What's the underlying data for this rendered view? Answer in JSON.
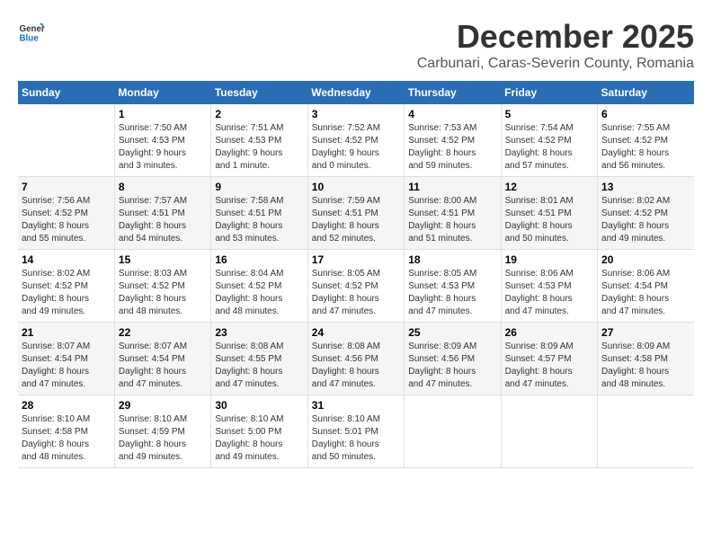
{
  "header": {
    "logo_general": "General",
    "logo_blue": "Blue",
    "title": "December 2025",
    "subtitle": "Carbunari, Caras-Severin County, Romania"
  },
  "calendar": {
    "weekdays": [
      "Sunday",
      "Monday",
      "Tuesday",
      "Wednesday",
      "Thursday",
      "Friday",
      "Saturday"
    ],
    "weeks": [
      [
        {
          "day": "",
          "sunrise": "",
          "sunset": "",
          "daylight": ""
        },
        {
          "day": "1",
          "sunrise": "Sunrise: 7:50 AM",
          "sunset": "Sunset: 4:53 PM",
          "daylight": "Daylight: 9 hours and 3 minutes."
        },
        {
          "day": "2",
          "sunrise": "Sunrise: 7:51 AM",
          "sunset": "Sunset: 4:53 PM",
          "daylight": "Daylight: 9 hours and 1 minute."
        },
        {
          "day": "3",
          "sunrise": "Sunrise: 7:52 AM",
          "sunset": "Sunset: 4:52 PM",
          "daylight": "Daylight: 9 hours and 0 minutes."
        },
        {
          "day": "4",
          "sunrise": "Sunrise: 7:53 AM",
          "sunset": "Sunset: 4:52 PM",
          "daylight": "Daylight: 8 hours and 59 minutes."
        },
        {
          "day": "5",
          "sunrise": "Sunrise: 7:54 AM",
          "sunset": "Sunset: 4:52 PM",
          "daylight": "Daylight: 8 hours and 57 minutes."
        },
        {
          "day": "6",
          "sunrise": "Sunrise: 7:55 AM",
          "sunset": "Sunset: 4:52 PM",
          "daylight": "Daylight: 8 hours and 56 minutes."
        }
      ],
      [
        {
          "day": "7",
          "sunrise": "Sunrise: 7:56 AM",
          "sunset": "Sunset: 4:52 PM",
          "daylight": "Daylight: 8 hours and 55 minutes."
        },
        {
          "day": "8",
          "sunrise": "Sunrise: 7:57 AM",
          "sunset": "Sunset: 4:51 PM",
          "daylight": "Daylight: 8 hours and 54 minutes."
        },
        {
          "day": "9",
          "sunrise": "Sunrise: 7:58 AM",
          "sunset": "Sunset: 4:51 PM",
          "daylight": "Daylight: 8 hours and 53 minutes."
        },
        {
          "day": "10",
          "sunrise": "Sunrise: 7:59 AM",
          "sunset": "Sunset: 4:51 PM",
          "daylight": "Daylight: 8 hours and 52 minutes."
        },
        {
          "day": "11",
          "sunrise": "Sunrise: 8:00 AM",
          "sunset": "Sunset: 4:51 PM",
          "daylight": "Daylight: 8 hours and 51 minutes."
        },
        {
          "day": "12",
          "sunrise": "Sunrise: 8:01 AM",
          "sunset": "Sunset: 4:51 PM",
          "daylight": "Daylight: 8 hours and 50 minutes."
        },
        {
          "day": "13",
          "sunrise": "Sunrise: 8:02 AM",
          "sunset": "Sunset: 4:52 PM",
          "daylight": "Daylight: 8 hours and 49 minutes."
        }
      ],
      [
        {
          "day": "14",
          "sunrise": "Sunrise: 8:02 AM",
          "sunset": "Sunset: 4:52 PM",
          "daylight": "Daylight: 8 hours and 49 minutes."
        },
        {
          "day": "15",
          "sunrise": "Sunrise: 8:03 AM",
          "sunset": "Sunset: 4:52 PM",
          "daylight": "Daylight: 8 hours and 48 minutes."
        },
        {
          "day": "16",
          "sunrise": "Sunrise: 8:04 AM",
          "sunset": "Sunset: 4:52 PM",
          "daylight": "Daylight: 8 hours and 48 minutes."
        },
        {
          "day": "17",
          "sunrise": "Sunrise: 8:05 AM",
          "sunset": "Sunset: 4:52 PM",
          "daylight": "Daylight: 8 hours and 47 minutes."
        },
        {
          "day": "18",
          "sunrise": "Sunrise: 8:05 AM",
          "sunset": "Sunset: 4:53 PM",
          "daylight": "Daylight: 8 hours and 47 minutes."
        },
        {
          "day": "19",
          "sunrise": "Sunrise: 8:06 AM",
          "sunset": "Sunset: 4:53 PM",
          "daylight": "Daylight: 8 hours and 47 minutes."
        },
        {
          "day": "20",
          "sunrise": "Sunrise: 8:06 AM",
          "sunset": "Sunset: 4:54 PM",
          "daylight": "Daylight: 8 hours and 47 minutes."
        }
      ],
      [
        {
          "day": "21",
          "sunrise": "Sunrise: 8:07 AM",
          "sunset": "Sunset: 4:54 PM",
          "daylight": "Daylight: 8 hours and 47 minutes."
        },
        {
          "day": "22",
          "sunrise": "Sunrise: 8:07 AM",
          "sunset": "Sunset: 4:54 PM",
          "daylight": "Daylight: 8 hours and 47 minutes."
        },
        {
          "day": "23",
          "sunrise": "Sunrise: 8:08 AM",
          "sunset": "Sunset: 4:55 PM",
          "daylight": "Daylight: 8 hours and 47 minutes."
        },
        {
          "day": "24",
          "sunrise": "Sunrise: 8:08 AM",
          "sunset": "Sunset: 4:56 PM",
          "daylight": "Daylight: 8 hours and 47 minutes."
        },
        {
          "day": "25",
          "sunrise": "Sunrise: 8:09 AM",
          "sunset": "Sunset: 4:56 PM",
          "daylight": "Daylight: 8 hours and 47 minutes."
        },
        {
          "day": "26",
          "sunrise": "Sunrise: 8:09 AM",
          "sunset": "Sunset: 4:57 PM",
          "daylight": "Daylight: 8 hours and 47 minutes."
        },
        {
          "day": "27",
          "sunrise": "Sunrise: 8:09 AM",
          "sunset": "Sunset: 4:58 PM",
          "daylight": "Daylight: 8 hours and 48 minutes."
        }
      ],
      [
        {
          "day": "28",
          "sunrise": "Sunrise: 8:10 AM",
          "sunset": "Sunset: 4:58 PM",
          "daylight": "Daylight: 8 hours and 48 minutes."
        },
        {
          "day": "29",
          "sunrise": "Sunrise: 8:10 AM",
          "sunset": "Sunset: 4:59 PM",
          "daylight": "Daylight: 8 hours and 49 minutes."
        },
        {
          "day": "30",
          "sunrise": "Sunrise: 8:10 AM",
          "sunset": "Sunset: 5:00 PM",
          "daylight": "Daylight: 8 hours and 49 minutes."
        },
        {
          "day": "31",
          "sunrise": "Sunrise: 8:10 AM",
          "sunset": "Sunset: 5:01 PM",
          "daylight": "Daylight: 8 hours and 50 minutes."
        },
        {
          "day": "",
          "sunrise": "",
          "sunset": "",
          "daylight": ""
        },
        {
          "day": "",
          "sunrise": "",
          "sunset": "",
          "daylight": ""
        },
        {
          "day": "",
          "sunrise": "",
          "sunset": "",
          "daylight": ""
        }
      ]
    ]
  }
}
